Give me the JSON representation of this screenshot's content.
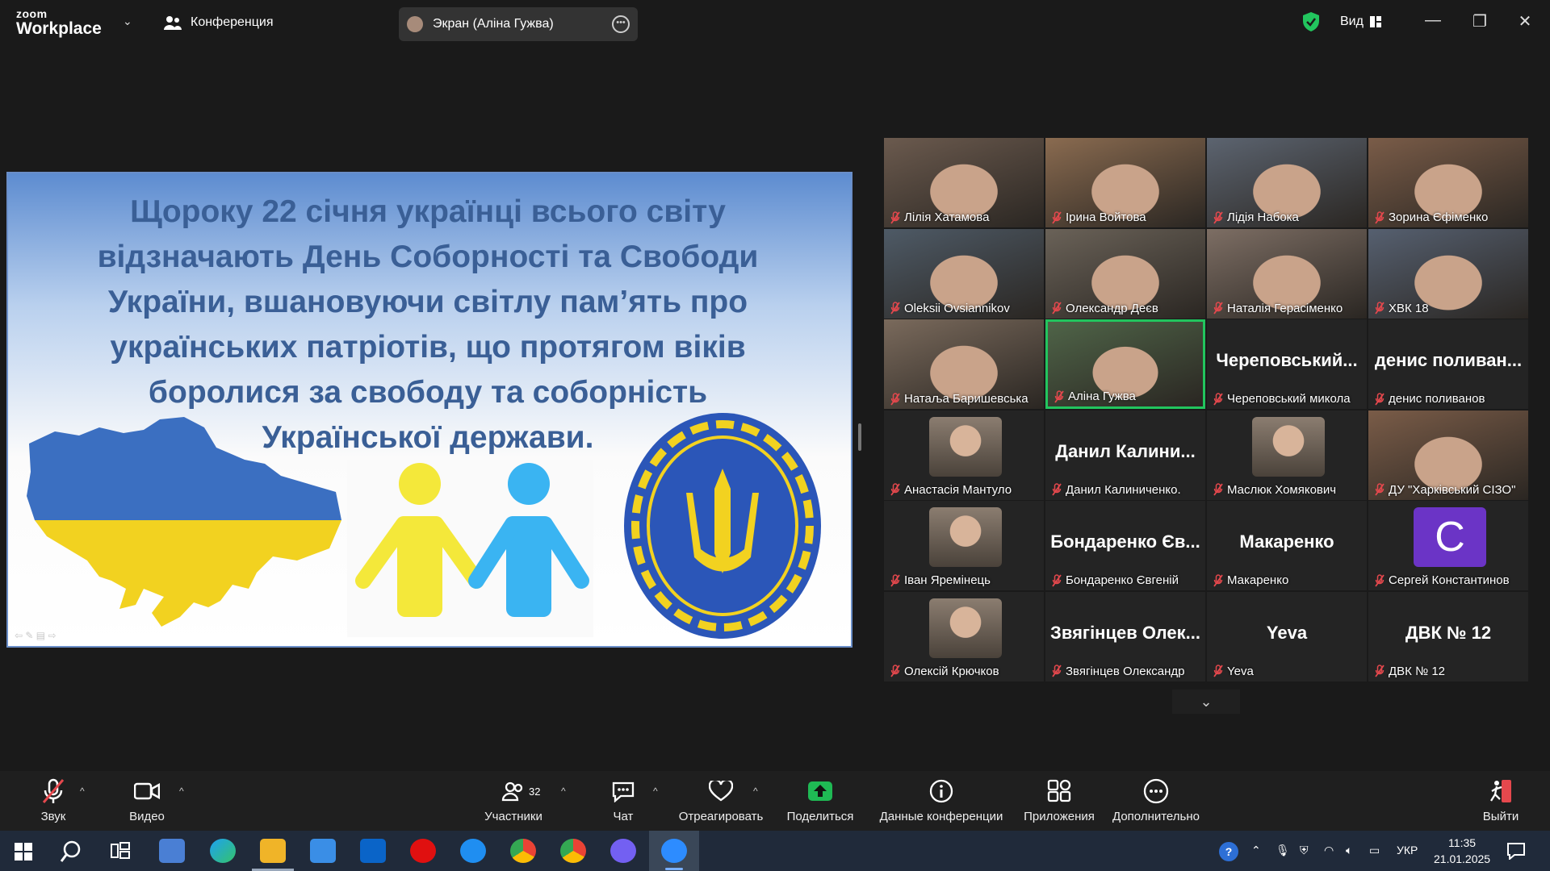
{
  "titlebar": {
    "logo_top": "zoom",
    "logo_bottom": "Workplace",
    "meeting_label": "Конференция",
    "screen_share_label": "Экран (Аліна Гужва)",
    "view_label": "Вид"
  },
  "slide": {
    "lines": [
      "Щороку 22 січня українці всього світу",
      "відзначають День Соборності та Свободи",
      "України, вшановуючи світлу пам’ять про",
      "українських патріотів, що протягом віків",
      "боролися за свободу та соборність",
      "Української держави."
    ]
  },
  "participants": [
    {
      "name": "Лілія Хатамова",
      "video": true
    },
    {
      "name": "Ірина Войтова",
      "video": true
    },
    {
      "name": "Лідія Набока",
      "video": true
    },
    {
      "name": "Зорина  Єфіменко",
      "video": true
    },
    {
      "name": "Oleksii Ovsiannikov",
      "video": true
    },
    {
      "name": "Олександр Деєв",
      "video": true
    },
    {
      "name": "Наталія Герасіменко",
      "video": true
    },
    {
      "name": "ХВК 18",
      "video": true
    },
    {
      "name": "Натаља Баришевська",
      "video": true
    },
    {
      "name": "Аліна Гужва",
      "video": true,
      "active": true
    },
    {
      "name": "Череповський микола",
      "display": "Череповський..."
    },
    {
      "name": "денис поливанов",
      "display": "денис поливан..."
    },
    {
      "name": "Анастасія Мантуло",
      "photo": true
    },
    {
      "name": "Данил Калиниченко.",
      "display": "Данил  Калини..."
    },
    {
      "name": "Маслюк Хомякович",
      "photo": true
    },
    {
      "name": "ДУ \"Харківський СІЗО\"",
      "video": true
    },
    {
      "name": "Іван Яремінець",
      "photo": true
    },
    {
      "name": "Бондаренко Євгеній",
      "display": "Бондаренко Єв..."
    },
    {
      "name": "Макаренко",
      "display": "Макаренко"
    },
    {
      "name": "Сергей Константинов",
      "initial": "C"
    },
    {
      "name": "Олексій Крючков",
      "photo": true
    },
    {
      "name": "Звягінцев Олександр",
      "display": "Звягінцев  Олек..."
    },
    {
      "name": "Yeva",
      "display": "Yeva"
    },
    {
      "name": "ДВК № 12",
      "display": "ДВК № 12"
    }
  ],
  "toolbar": {
    "audio": "Звук",
    "video": "Видео",
    "participants": "Участники",
    "participants_count": "32",
    "chat": "Чат",
    "react": "Отреагировать",
    "share": "Поделиться",
    "info": "Данные конференции",
    "apps": "Приложения",
    "more": "Дополнительно",
    "leave": "Выйти"
  },
  "taskbar": {
    "lang": "УКР",
    "time": "11:35",
    "date": "21.01.2025"
  },
  "colors": {
    "accent_green": "#22c55e",
    "share_green": "#1fb954",
    "muted_red": "#e5484d",
    "slide_text": "#3a5f96",
    "ukraine_blue": "#3b6fc1",
    "ukraine_yellow": "#f2d220"
  }
}
